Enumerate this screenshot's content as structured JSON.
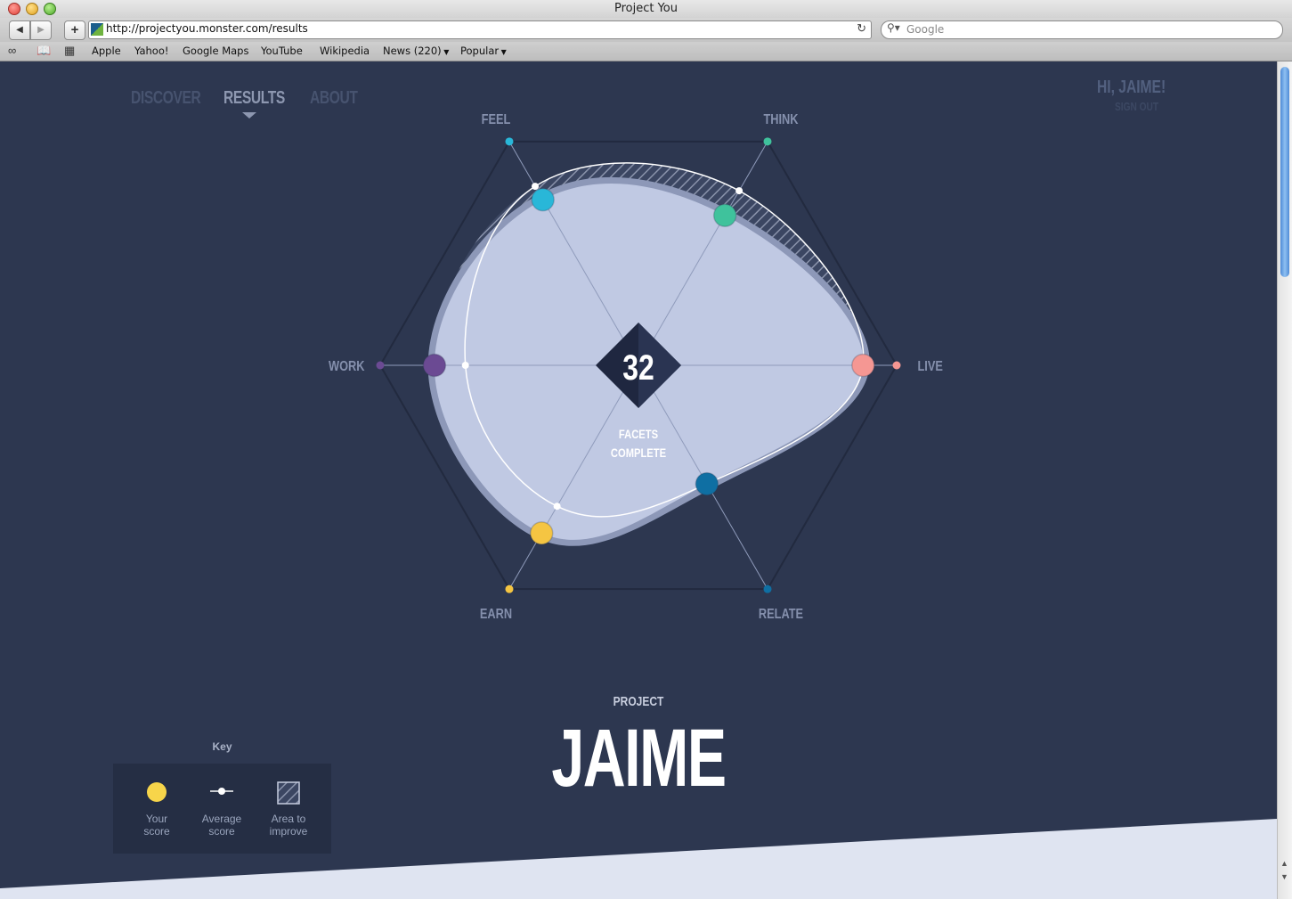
{
  "window": {
    "title": "Project You"
  },
  "toolbar": {
    "url": "http://projectyou.monster.com/results",
    "search_placeholder": "Google"
  },
  "bookmarks": {
    "items": [
      {
        "label": "Apple"
      },
      {
        "label": "Yahoo!"
      },
      {
        "label": "Google Maps"
      },
      {
        "label": "YouTube"
      },
      {
        "label": "Wikipedia"
      },
      {
        "label": "News (220)"
      },
      {
        "label": "Popular"
      }
    ]
  },
  "nav": {
    "items": [
      {
        "label": "DISCOVER",
        "active": false
      },
      {
        "label": "RESULTS",
        "active": true
      },
      {
        "label": "ABOUT",
        "active": false
      }
    ]
  },
  "user": {
    "greeting": "HI, JAIME!",
    "signout": "SIGN OUT"
  },
  "radar": {
    "center_value": "32",
    "center_caption_1": "FACETS",
    "center_caption_2": "COMPLETE",
    "axes": [
      {
        "label": "FEEL",
        "color": "#29b7d8"
      },
      {
        "label": "THINK",
        "color": "#3fc29c"
      },
      {
        "label": "LIVE",
        "color": "#f59793"
      },
      {
        "label": "RELATE",
        "color": "#0f6fa3"
      },
      {
        "label": "EARN",
        "color": "#f5c542"
      },
      {
        "label": "WORK",
        "color": "#6b4a93"
      }
    ],
    "your_score": [
      0.74,
      0.67,
      0.87,
      0.53,
      0.75,
      0.79
    ],
    "average_score": [
      0.8,
      0.78,
      0.87,
      0.53,
      0.63,
      0.67
    ]
  },
  "project": {
    "label": "PROJECT",
    "name": "JAIME"
  },
  "key": {
    "title": "Key",
    "items": [
      {
        "line1": "Your",
        "line2": "score"
      },
      {
        "line1": "Average",
        "line2": "score"
      },
      {
        "line1": "Area to",
        "line2": "improve"
      }
    ]
  },
  "colors": {
    "background": "#2d3750",
    "shape_fill": "#c0c9e3",
    "footer_band": "#dfe4f1"
  }
}
